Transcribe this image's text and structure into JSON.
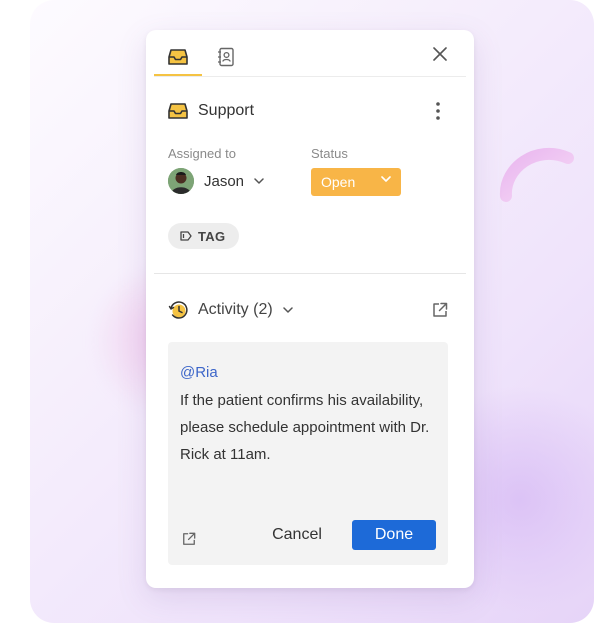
{
  "panel": {
    "tabs": [
      {
        "icon": "inbox-icon",
        "active": true
      },
      {
        "icon": "contacts-icon",
        "active": false
      }
    ],
    "title": "Support",
    "assigned_label": "Assigned to",
    "assignee": "Jason",
    "status_label": "Status",
    "status_value": "Open",
    "tag": "TAG",
    "activity_title": "Activity (2)"
  },
  "comment": {
    "mention": "@Ria",
    "text": "If the patient confirms his availability, please schedule appointment with Dr. Rick at 11am.",
    "cancel_label": "Cancel",
    "done_label": "Done"
  },
  "colors": {
    "accent_yellow": "#f5c343",
    "status_orange": "#f8b547",
    "primary_blue": "#1d6ad8",
    "mention_blue": "#3d66c9"
  }
}
